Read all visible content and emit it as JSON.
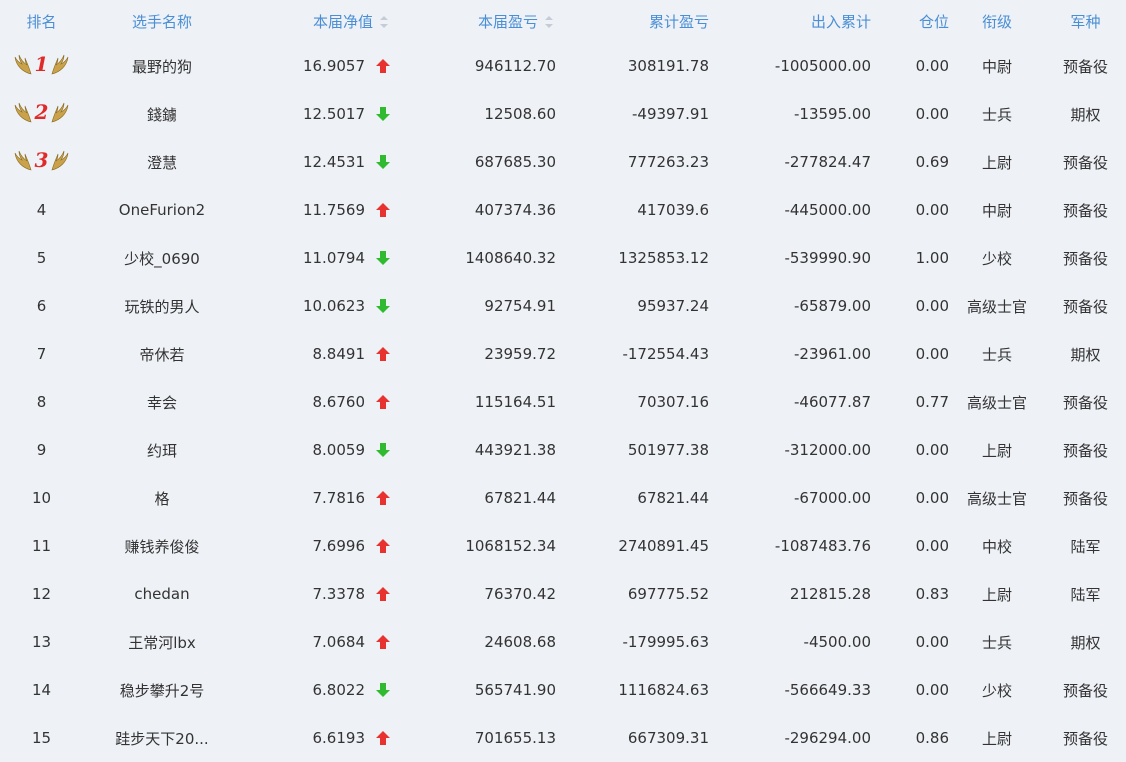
{
  "header": {
    "rank": "排名",
    "name": "选手名称",
    "nav": "本届净值",
    "pnl": "本届盈亏",
    "cum": "累计盈亏",
    "flow": "出入累计",
    "pos": "仓位",
    "title": "衔级",
    "branch": "军种"
  },
  "colors": {
    "up": "#e8322f",
    "down": "#2fba2f",
    "header_text": "#4a8fd6",
    "medal_num": "#e02a2a"
  },
  "rows": [
    {
      "rank": "1",
      "name": "最野的狗",
      "nav": "16.9057",
      "trend": "up",
      "pnl": "946112.70",
      "cum": "308191.78",
      "flow": "-1005000.00",
      "pos": "0.00",
      "title": "中尉",
      "branch": "预备役"
    },
    {
      "rank": "2",
      "name": "錢鐪",
      "nav": "12.5017",
      "trend": "down",
      "pnl": "12508.60",
      "cum": "-49397.91",
      "flow": "-13595.00",
      "pos": "0.00",
      "title": "士兵",
      "branch": "期权"
    },
    {
      "rank": "3",
      "name": "澄慧",
      "nav": "12.4531",
      "trend": "down",
      "pnl": "687685.30",
      "cum": "777263.23",
      "flow": "-277824.47",
      "pos": "0.69",
      "title": "上尉",
      "branch": "预备役"
    },
    {
      "rank": "4",
      "name": "OneFurion2",
      "nav": "11.7569",
      "trend": "up",
      "pnl": "407374.36",
      "cum": "417039.6",
      "flow": "-445000.00",
      "pos": "0.00",
      "title": "中尉",
      "branch": "预备役"
    },
    {
      "rank": "5",
      "name": "少校_0690",
      "nav": "11.0794",
      "trend": "down",
      "pnl": "1408640.32",
      "cum": "1325853.12",
      "flow": "-539990.90",
      "pos": "1.00",
      "title": "少校",
      "branch": "预备役"
    },
    {
      "rank": "6",
      "name": "玩铁的男人",
      "nav": "10.0623",
      "trend": "down",
      "pnl": "92754.91",
      "cum": "95937.24",
      "flow": "-65879.00",
      "pos": "0.00",
      "title": "高级士官",
      "branch": "预备役"
    },
    {
      "rank": "7",
      "name": "帝休若",
      "nav": "8.8491",
      "trend": "up",
      "pnl": "23959.72",
      "cum": "-172554.43",
      "flow": "-23961.00",
      "pos": "0.00",
      "title": "士兵",
      "branch": "期权"
    },
    {
      "rank": "8",
      "name": "幸会",
      "nav": "8.6760",
      "trend": "up",
      "pnl": "115164.51",
      "cum": "70307.16",
      "flow": "-46077.87",
      "pos": "0.77",
      "title": "高级士官",
      "branch": "预备役"
    },
    {
      "rank": "9",
      "name": "约珥",
      "nav": "8.0059",
      "trend": "down",
      "pnl": "443921.38",
      "cum": "501977.38",
      "flow": "-312000.00",
      "pos": "0.00",
      "title": "上尉",
      "branch": "预备役"
    },
    {
      "rank": "10",
      "name": "格",
      "nav": "7.7816",
      "trend": "up",
      "pnl": "67821.44",
      "cum": "67821.44",
      "flow": "-67000.00",
      "pos": "0.00",
      "title": "高级士官",
      "branch": "预备役"
    },
    {
      "rank": "11",
      "name": "赚钱养俊俊",
      "nav": "7.6996",
      "trend": "up",
      "pnl": "1068152.34",
      "cum": "2740891.45",
      "flow": "-1087483.76",
      "pos": "0.00",
      "title": "中校",
      "branch": "陆军"
    },
    {
      "rank": "12",
      "name": "chedan",
      "nav": "7.3378",
      "trend": "up",
      "pnl": "76370.42",
      "cum": "697775.52",
      "flow": "212815.28",
      "pos": "0.83",
      "title": "上尉",
      "branch": "陆军"
    },
    {
      "rank": "13",
      "name": "王常河lbx",
      "nav": "7.0684",
      "trend": "up",
      "pnl": "24608.68",
      "cum": "-179995.63",
      "flow": "-4500.00",
      "pos": "0.00",
      "title": "士兵",
      "branch": "期权"
    },
    {
      "rank": "14",
      "name": "稳步攀升2号",
      "nav": "6.8022",
      "trend": "down",
      "pnl": "565741.90",
      "cum": "1116824.63",
      "flow": "-566649.33",
      "pos": "0.00",
      "title": "少校",
      "branch": "预备役"
    },
    {
      "rank": "15",
      "name": "跬步天下20...",
      "nav": "6.6193",
      "trend": "up",
      "pnl": "701655.13",
      "cum": "667309.31",
      "flow": "-296294.00",
      "pos": "0.86",
      "title": "上尉",
      "branch": "预备役"
    }
  ]
}
